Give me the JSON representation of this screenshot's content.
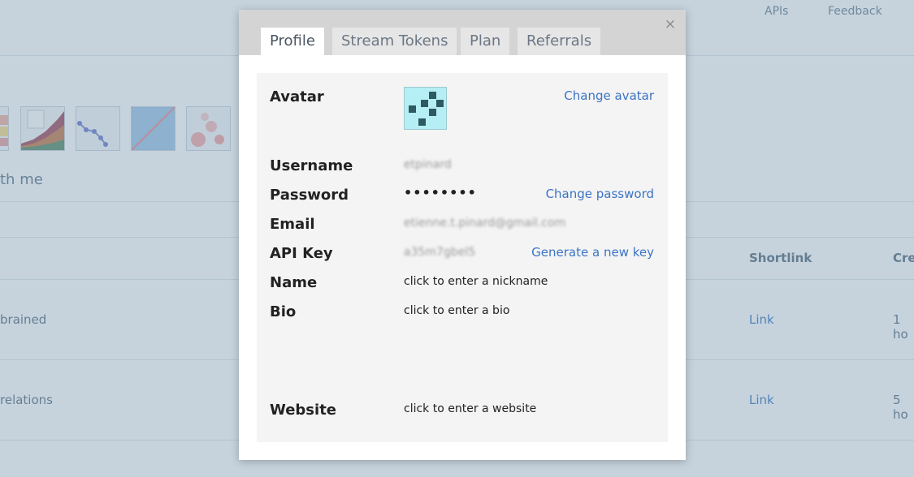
{
  "background": {
    "nav": {
      "apis": "APIs",
      "feedback": "Feedback"
    },
    "section_heading": "th me",
    "table": {
      "headers": {
        "shortlink": "Shortlink",
        "created": "Cre"
      },
      "rows": [
        {
          "name": "brained",
          "shortlink": "Link",
          "created": "1 ho"
        },
        {
          "name": "relations",
          "shortlink": "Link",
          "created": "5 ho"
        }
      ]
    }
  },
  "modal": {
    "close_label": "×",
    "tabs": [
      {
        "label": "Profile",
        "active": true
      },
      {
        "label": "Stream Tokens",
        "active": false
      },
      {
        "label": "Plan",
        "active": false
      },
      {
        "label": "Referrals",
        "active": false
      }
    ],
    "profile": {
      "avatar": {
        "label": "Avatar",
        "action": "Change avatar"
      },
      "username": {
        "label": "Username",
        "value": "etpinard"
      },
      "password": {
        "label": "Password",
        "value": "••••••••",
        "action": "Change password"
      },
      "email": {
        "label": "Email",
        "value": "etienne.t.pinard@gmail.com"
      },
      "api_key": {
        "label": "API Key",
        "value": "a35m7gbel5",
        "action": "Generate a new key"
      },
      "name": {
        "label": "Name",
        "placeholder": "click to enter a nickname"
      },
      "bio": {
        "label": "Bio",
        "placeholder": "click to enter a bio"
      },
      "website": {
        "label": "Website",
        "placeholder": "click to enter a website"
      }
    }
  },
  "colors": {
    "link": "#3b74c4",
    "panel": "#f4f4f4",
    "tab_bar": "#d4d4d4",
    "avatar_bg": "#b5eef5"
  }
}
